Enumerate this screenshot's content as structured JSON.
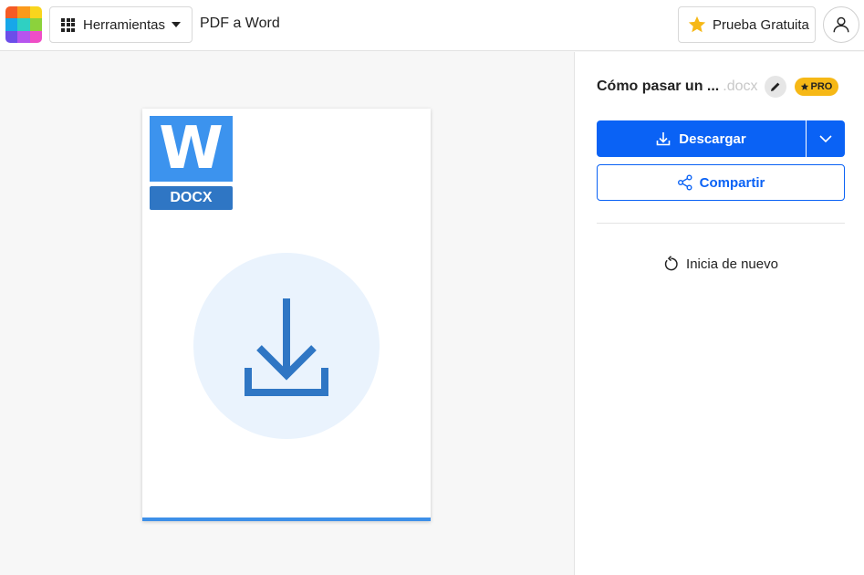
{
  "header": {
    "logo_colors": [
      "#f45b25",
      "#fb9a1c",
      "#f9d51d",
      "#17a7e9",
      "#2fd0c2",
      "#8cd23c",
      "#6c4ee9",
      "#b655ee",
      "#ef4ec6"
    ],
    "tools_label": "Herramientas",
    "page_title": "PDF a Word",
    "trial_label": "Prueba Gratuita",
    "star_color": "#f6b816"
  },
  "preview": {
    "badge_letter": "W",
    "badge_ext": "DOCX",
    "accent_color": "#3c93ee",
    "icon": "download-icon"
  },
  "panel": {
    "file_name": "Cómo pasar un ...",
    "file_ext": ".docx",
    "pro_label": "PRO",
    "download_label": "Descargar",
    "share_label": "Compartir",
    "restart_label": "Inicia de nuevo",
    "primary_color": "#0a62f5"
  }
}
